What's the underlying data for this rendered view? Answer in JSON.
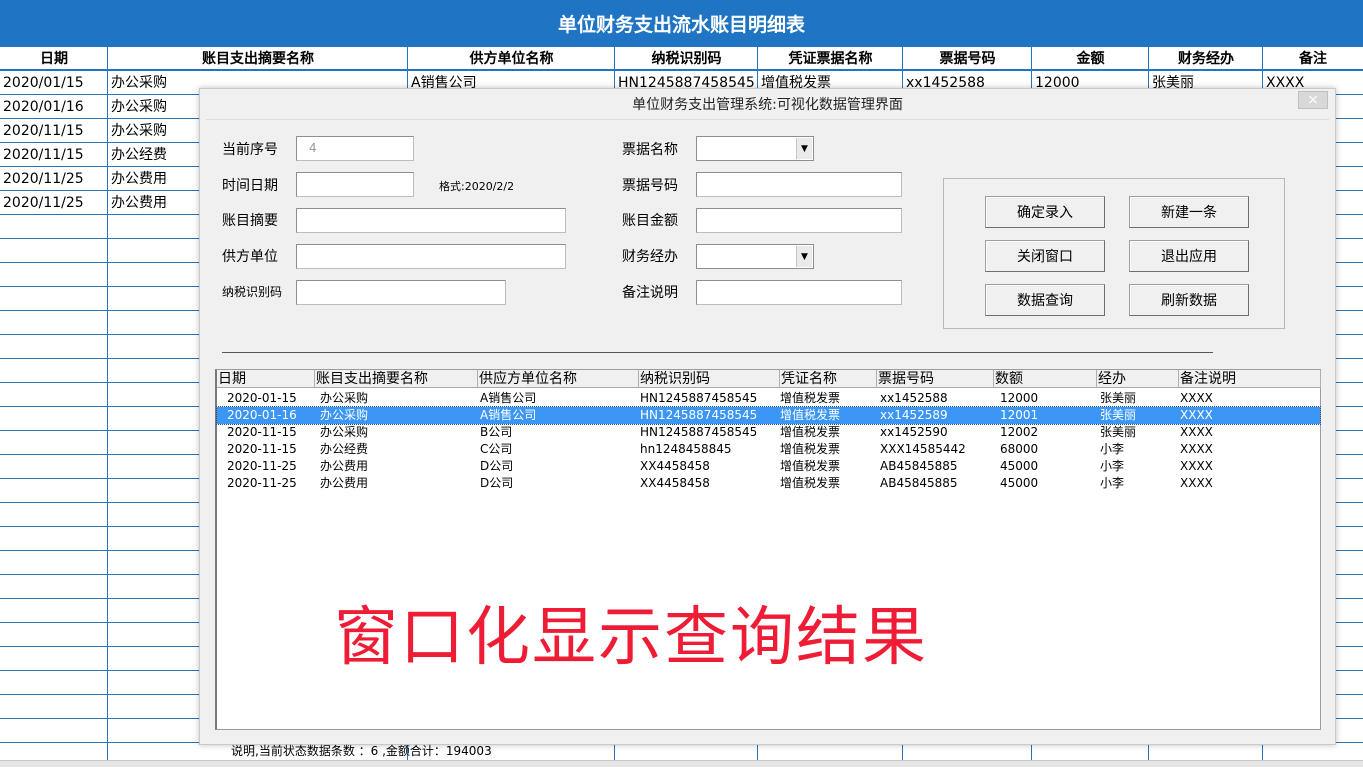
{
  "sheet": {
    "title": "单位财务支出流水账目明细表",
    "headers": [
      "日期",
      "账目支出摘要名称",
      "供方单位名称",
      "纳税识别码",
      "凭证票据名称",
      "票据号码",
      "金额",
      "财务经办",
      "备注"
    ],
    "first_row": [
      "2020/01/15",
      "办公采购",
      "A销售公司",
      "HN1245887458545",
      "增值税发票",
      "xx1452588",
      "12000",
      "张美丽",
      "XXXX"
    ],
    "visible_dates": [
      "2020/01/16",
      "2020/11/15",
      "2020/11/15",
      "2020/11/25",
      "2020/11/25"
    ],
    "visible_summaries": [
      "办公采购",
      "办公采购",
      "办公经费",
      "办公费用",
      "办公费用"
    ]
  },
  "dialog": {
    "title": "单位财务支出管理系统:可视化数据管理界面",
    "close_label": "×",
    "form": {
      "seq_label": "当前序号",
      "seq_value": "4",
      "date_label": "时间日期",
      "date_hint": "格式:2020/2/2",
      "summary_label": "账目摘要",
      "supplier_label": "供方单位",
      "taxid_label": "纳税识别码",
      "bill_name_label": "票据名称",
      "bill_no_label": "票据号码",
      "amount_label": "账目金额",
      "handler_label": "财务经办",
      "remark_label": "备注说明"
    },
    "buttons": {
      "confirm": "确定录入",
      "new": "新建一条",
      "close": "关闭窗口",
      "exit": "退出应用",
      "query": "数据查询",
      "refresh": "刷新数据"
    },
    "list": {
      "headers": [
        "日期",
        "账目支出摘要名称",
        "供应方单位名称",
        "纳税识别码",
        "凭证名称",
        "票据号码",
        "数额",
        "经办",
        "备注说明"
      ],
      "rows": [
        [
          "2020-01-15",
          "办公采购",
          "A销售公司",
          "HN1245887458545",
          "增值税发票",
          "xx1452588",
          "12000",
          "张美丽",
          "XXXX"
        ],
        [
          "2020-01-16",
          "办公采购",
          "A销售公司",
          "HN1245887458545",
          "增值税发票",
          "xx1452589",
          "12001",
          "张美丽",
          "XXXX"
        ],
        [
          "2020-11-15",
          "办公采购",
          "B公司",
          "HN1245887458545",
          "增值税发票",
          "xx1452590",
          "12002",
          "张美丽",
          "XXXX"
        ],
        [
          "2020-11-15",
          "办公经费",
          "C公司",
          "hn1248458845",
          "增值税发票",
          "XXX14585442",
          "68000",
          "小李",
          "XXXX"
        ],
        [
          "2020-11-25",
          "办公费用",
          "D公司",
          "XX4458458",
          "增值税发票",
          "AB45845885",
          "45000",
          "小李",
          "XXXX"
        ],
        [
          "2020-11-25",
          "办公费用",
          "D公司",
          "XX4458458",
          "增值税发票",
          "AB45845885",
          "45000",
          "小李",
          "XXXX"
        ]
      ],
      "selected_index": 1
    },
    "overlay_caption": "窗口化显示查询结果",
    "status": "说明,当前状态数据条数 ：6 ,金额合计：194003"
  },
  "colors": {
    "sheet_blue": "#1f74c3",
    "selection_blue": "#3c96f5",
    "caption_red": "#ef1c36"
  }
}
